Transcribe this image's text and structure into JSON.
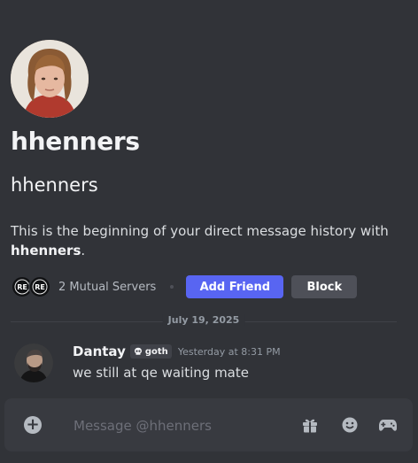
{
  "profile": {
    "display_name": "hhenners",
    "username": "hhenners",
    "intro_prefix": "This is the beginning of your direct message history with ",
    "intro_name": "hhenners",
    "intro_suffix": ".",
    "mutual_servers": "2 Mutual Servers",
    "mutual_server_icons": [
      {
        "label": "RE"
      },
      {
        "label": "RE"
      }
    ],
    "add_friend_label": "Add Friend",
    "block_label": "Block"
  },
  "date_divider": "July 19, 2025",
  "messages": [
    {
      "author": "Dantay",
      "tag": "goth",
      "tag_icon": "skull-icon",
      "timestamp": "Yesterday at 8:31 PM",
      "text": "we still at qe waiting mate"
    }
  ],
  "composer": {
    "placeholder": "Message @hhenners",
    "icons": [
      "add-attachment-icon",
      "gift-icon",
      "emoji-icon",
      "activities-icon"
    ]
  },
  "colors": {
    "background": "#313338",
    "accent": "#5865f2",
    "secondary_button": "#4e5058",
    "composer": "#383a40"
  }
}
